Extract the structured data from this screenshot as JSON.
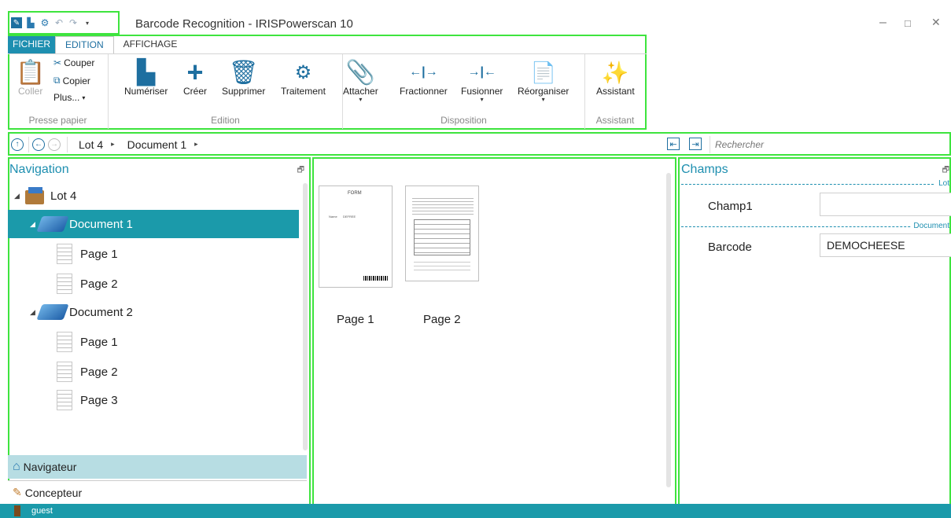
{
  "window": {
    "title": "Barcode Recognition - IRISPowerscan 10",
    "minimize": "–",
    "maximize": "□",
    "close": "✕"
  },
  "ribbon": {
    "tabs": [
      {
        "label": "FICHIER"
      },
      {
        "label": "EDITION"
      },
      {
        "label": "AFFICHAGE"
      }
    ],
    "clipboard": {
      "label": "Presse papier",
      "paste": "Coller",
      "cut": "Couper",
      "copy": "Copier",
      "more": "Plus..."
    },
    "edition": {
      "label": "Edition",
      "scan": "Numériser",
      "create": "Créer",
      "delete": "Supprimer",
      "process": "Traitement"
    },
    "layout": {
      "label": "Disposition",
      "attach": "Attacher",
      "split": "Fractionner",
      "merge": "Fusionner",
      "reorganize": "Réorganiser"
    },
    "assistant": {
      "label": "Assistant",
      "wizard": "Assistant"
    }
  },
  "addressbar": {
    "crumbs": [
      "Lot 4",
      "Document 1"
    ],
    "search_placeholder": "Rechercher"
  },
  "navigation": {
    "title": "Navigation",
    "tree": {
      "lot": "Lot 4",
      "doc1": "Document 1",
      "doc1_pages": [
        "Page 1",
        "Page 2"
      ],
      "doc2": "Document 2",
      "doc2_pages": [
        "Page 1",
        "Page 2",
        "Page 3"
      ]
    },
    "tabs": {
      "navigator": "Navigateur",
      "designer": "Concepteur"
    }
  },
  "pages": {
    "thumbs": [
      "Page 1",
      "Page 2"
    ],
    "thumb1_heading": "FORM",
    "thumb1_field": "Name",
    "thumb1_value": "DEFREE"
  },
  "fields": {
    "title": "Champs",
    "group_lot": "Lot",
    "group_document": "Document",
    "champ1_label": "Champ1",
    "champ1_value": "",
    "barcode_label": "Barcode",
    "barcode_value": "DEMOCHEESE"
  },
  "status": {
    "user": "guest"
  },
  "colors": {
    "accent": "#1b9aaa",
    "title_blue": "#1e8fb0",
    "icon_blue": "#1e6fa0",
    "highlight": "#3ee43e"
  }
}
